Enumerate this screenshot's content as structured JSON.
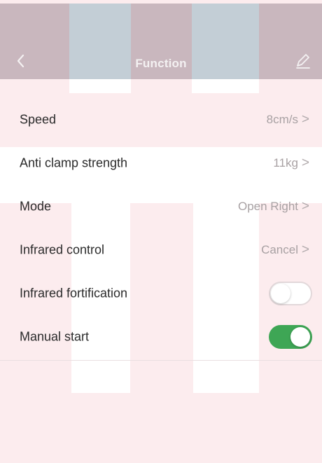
{
  "header": {
    "title": "Function",
    "back_icon": "chevron-left-icon",
    "edit_icon": "pencil-icon",
    "background": "#c9b7be"
  },
  "settings": {
    "speed": {
      "label": "Speed",
      "value": "8cm/s"
    },
    "anti_clamp": {
      "label": "Anti clamp strength",
      "value": "11kg"
    },
    "mode": {
      "label": "Mode",
      "value": "Open Right"
    },
    "infrared_control": {
      "label": "Infrared control",
      "value": "Cancel"
    },
    "infrared_fortification": {
      "label": "Infrared fortification",
      "enabled": false
    },
    "manual_start": {
      "label": "Manual start",
      "enabled": true
    }
  },
  "chevron": ">",
  "colors": {
    "toggle_on": "#3ea655",
    "value_text": "#a8a1a3",
    "page_background": "#fcecee"
  }
}
